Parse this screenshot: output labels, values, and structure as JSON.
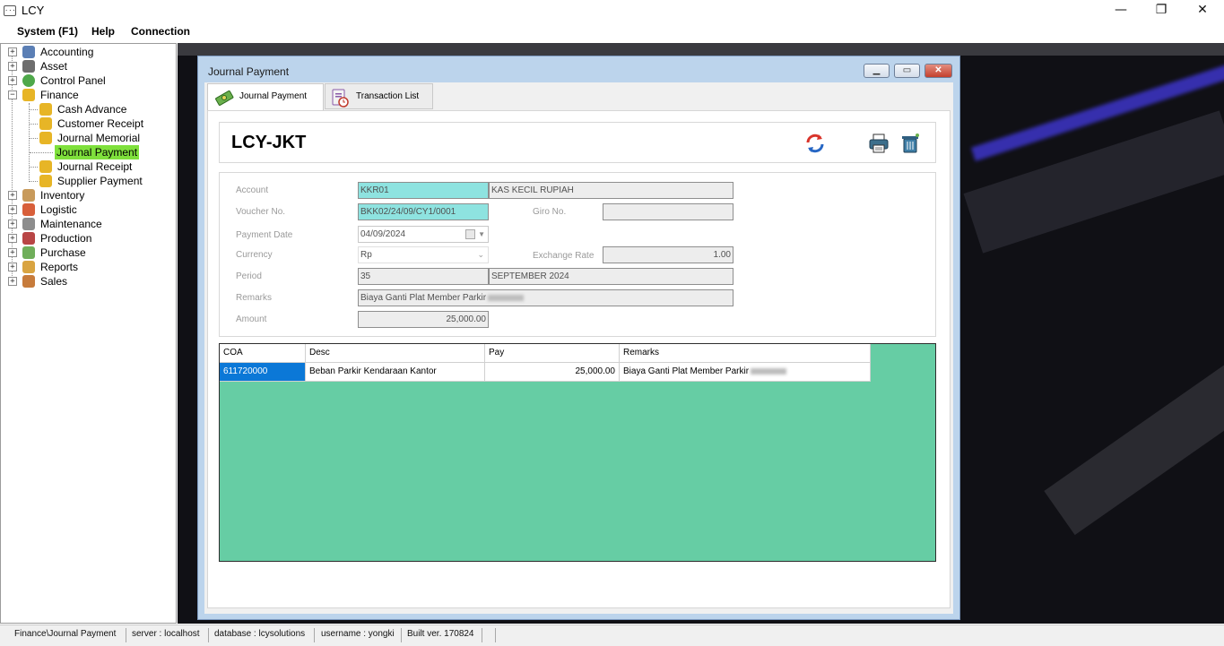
{
  "app": {
    "title": "LCY"
  },
  "window_controls": {
    "minimize": "—",
    "maximize": "❐",
    "close": "✕"
  },
  "menubar": {
    "items": [
      "System (F1)",
      "Help",
      "Connection"
    ]
  },
  "tree": {
    "top_items": [
      "Accounting",
      "Asset",
      "Control Panel",
      "Finance",
      "Inventory",
      "Logistic",
      "Maintenance",
      "Production",
      "Purchase",
      "Reports",
      "Sales"
    ],
    "finance_children": [
      "Cash Advance",
      "Customer Receipt",
      "Journal Memorial",
      "Journal Payment",
      "Journal Receipt",
      "Supplier Payment"
    ],
    "selected": "Journal Payment"
  },
  "child_window": {
    "title": "Journal Payment",
    "tabs": [
      "Journal Payment",
      "Transaction List"
    ]
  },
  "header": {
    "company": "LCY-JKT"
  },
  "form": {
    "account_label": "Account",
    "account_code": "KKR01",
    "account_name": "KAS KECIL RUPIAH",
    "voucher_label": "Voucher No.",
    "voucher_no": "BKK02/24/09/CY1/0001",
    "giro_label": "Giro No.",
    "giro_no": "",
    "payment_date_label": "Payment Date",
    "payment_date": "04/09/2024",
    "currency_label": "Currency",
    "currency": "Rp",
    "exchange_rate_label": "Exchange Rate",
    "exchange_rate": "1.00",
    "period_label": "Period",
    "period_no": "35",
    "period_name": "SEPTEMBER 2024",
    "remarks_label": "Remarks",
    "remarks": "Biaya Ganti Plat Member Parkir",
    "amount_label": "Amount",
    "amount": "25,000.00"
  },
  "grid": {
    "columns": [
      "COA",
      "Desc",
      "Pay",
      "Remarks"
    ],
    "rows": [
      {
        "coa": "611720000",
        "desc": "Beban Parkir Kendaraan Kantor",
        "pay": "25,000.00",
        "remarks": "Biaya Ganti Plat Member Parkir"
      }
    ]
  },
  "statusbar": {
    "path": "Finance\\Journal Payment",
    "server": "server : localhost",
    "database": "database : lcysolutions",
    "username": "username : yongki",
    "build": "Built ver. 170824"
  },
  "colors": {
    "selected_tree": "#7fe03c",
    "field_cyan": "#8ee3e0",
    "grid_bg": "#66cda4",
    "selected_cell": "#0b78d7"
  }
}
